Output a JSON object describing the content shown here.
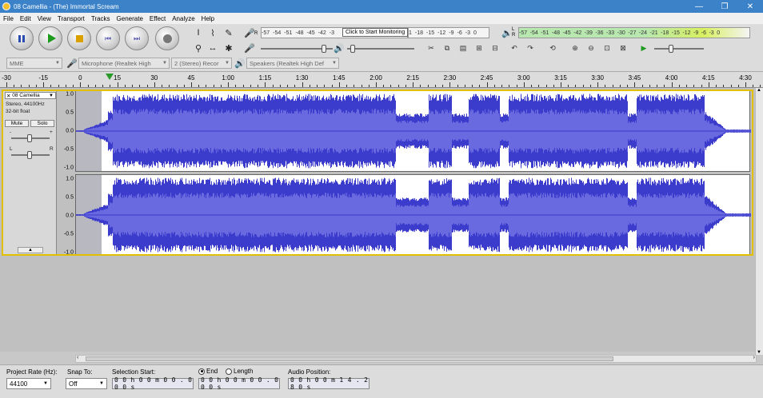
{
  "window": {
    "title": "08 Camellia - (The) Immortal Scream",
    "minimize": "—",
    "maximize": "❐",
    "close": "✕"
  },
  "menu": [
    "File",
    "Edit",
    "View",
    "Transport",
    "Tracks",
    "Generate",
    "Effect",
    "Analyze",
    "Help"
  ],
  "meters": {
    "record_ticks": [
      "-57",
      "-54",
      "-51",
      "-48",
      "-45",
      "-42",
      "-3",
      "Click to Start Monitoring",
      "1",
      "-18",
      "-15",
      "-12",
      "-9",
      "-6",
      "-3",
      "0"
    ],
    "record_scale_left": [
      "-57",
      "-54",
      "-51",
      "-48",
      "-45",
      "-42",
      "-3"
    ],
    "record_scale_right": [
      "1",
      "-18",
      "-15",
      "-12",
      "-9",
      "-6",
      "-3",
      "0"
    ],
    "monitor_tip": "Click to Start Monitoring",
    "play_scale": [
      "-57",
      "-54",
      "-51",
      "-48",
      "-45",
      "-42",
      "-39",
      "-36",
      "-33",
      "-30",
      "-27",
      "-24",
      "-21",
      "-18",
      "-15",
      "-12",
      "-9",
      "-6",
      "-3",
      "0"
    ],
    "rec_label": "R",
    "play_label": "R",
    "left_label": "L"
  },
  "device": {
    "host": "MME",
    "input": "Microphone (Realtek High",
    "channels": "2 (Stereo) Recor",
    "output": "Speakers (Realtek High Def"
  },
  "ruler": [
    "-30",
    "-15",
    "0",
    "15",
    "30",
    "45",
    "1:00",
    "1:15",
    "1:30",
    "1:45",
    "2:00",
    "2:15",
    "2:30",
    "2:45",
    "3:00",
    "3:15",
    "3:30",
    "3:45",
    "4:00",
    "4:15",
    "4:30"
  ],
  "track": {
    "name": "08 Camellia",
    "info1": "Stereo, 44100Hz",
    "info2": "32-bit float",
    "mute": "Mute",
    "solo": "Solo",
    "gain_minus": "-",
    "gain_plus": "+",
    "pan_left": "L",
    "pan_right": "R",
    "collapse": "▲",
    "scale": [
      "1.0",
      "0.5",
      "0.0",
      "-0.5",
      "-1.0"
    ]
  },
  "wave_color": "#3b3bcc",
  "wave_center": "#6a6ae0",
  "selection": {
    "project_rate_label": "Project Rate (Hz):",
    "project_rate": "44100",
    "snap_label": "Snap To:",
    "snap": "Off",
    "start_label": "Selection Start:",
    "start": "0 0 h 0 0 m 0 0 . 0 0 0 s",
    "end_label": "End",
    "length_label": "Length",
    "end": "0 0 h 0 0 m 0 0 . 0 0 0 s",
    "audio_pos_label": "Audio Position:",
    "audio_pos": "0 0 h 0 0 m 1 4 . 2 8 0 s"
  }
}
